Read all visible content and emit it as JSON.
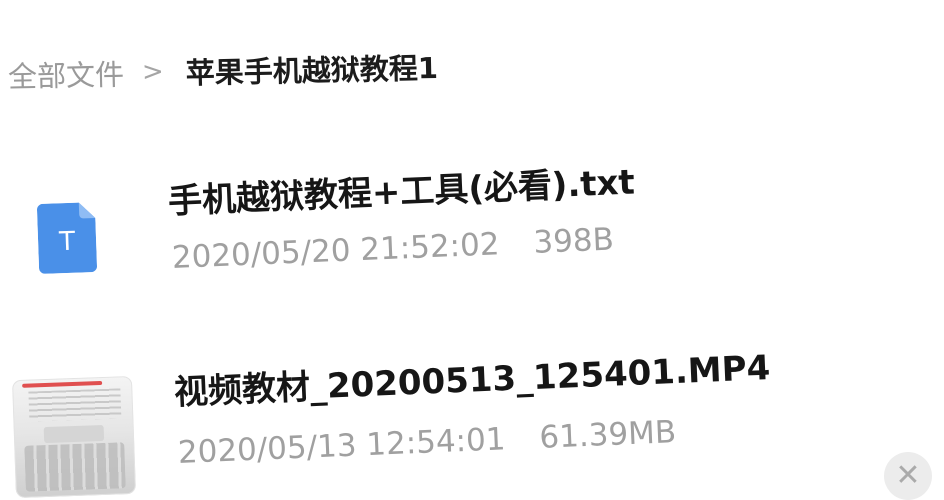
{
  "breadcrumb": {
    "root": "全部文件",
    "separator": ">",
    "current": "苹果手机越狱教程1"
  },
  "files": [
    {
      "name": "手机越狱教程+工具(必看).txt",
      "date": "2020/05/20 21:52:02",
      "size": "398B",
      "icon": "text-file-icon",
      "icon_letter": "T"
    },
    {
      "name": "视频教材_20200513_125401.MP4",
      "date": "2020/05/13 12:54:01",
      "size": "61.39MB",
      "icon": "video-thumbnail"
    }
  ],
  "close_button": {
    "glyph": "✕"
  },
  "colors": {
    "txt_icon": "#4a90e8",
    "primary_text": "#161616",
    "secondary_text": "#a0a0a0"
  }
}
